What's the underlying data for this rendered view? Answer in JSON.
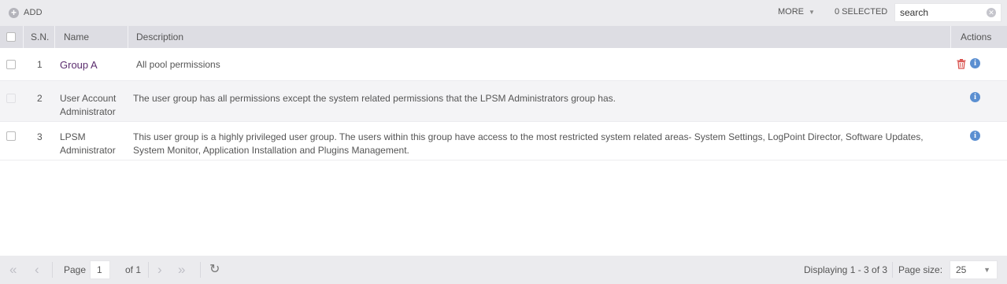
{
  "toolbar": {
    "add_label": "ADD",
    "more_label": "MORE",
    "selected_label": "0 SELECTED",
    "search_value": "search"
  },
  "table": {
    "headers": {
      "sn": "S.N.",
      "name": "Name",
      "description": "Description",
      "actions": "Actions"
    },
    "rows": [
      {
        "sn": "1",
        "name": "Group A",
        "description": "All pool permissions",
        "actions": [
          "delete-icon",
          "info-icon"
        ]
      },
      {
        "sn": "2",
        "name": "User Account Administrator",
        "description": "The user group has all permissions except the system related permissions that the LPSM Administrators group has.",
        "actions": [
          "info-icon"
        ]
      },
      {
        "sn": "3",
        "name": "LPSM Administrator",
        "description": "This user group is a highly privileged user group. The users within this group have access to the most restricted system related areas- System Settings, LogPoint Director, Software Updates, System Monitor, Application Installation and Plugins Management.",
        "actions": [
          "info-icon"
        ]
      }
    ]
  },
  "footer": {
    "page_label": "Page",
    "page_value": "1",
    "of_label": "of 1",
    "displaying": "Displaying 1 - 3 of 3",
    "page_size_label": "Page size:",
    "page_size_value": "25"
  },
  "colors": {
    "toolbar_bg": "#ebebee",
    "header_bg": "#dddde3",
    "alt_row_bg": "#f4f4f6",
    "link": "#5b2d6e",
    "info_icon": "#5b8fd1",
    "delete_icon": "#d9534f"
  }
}
